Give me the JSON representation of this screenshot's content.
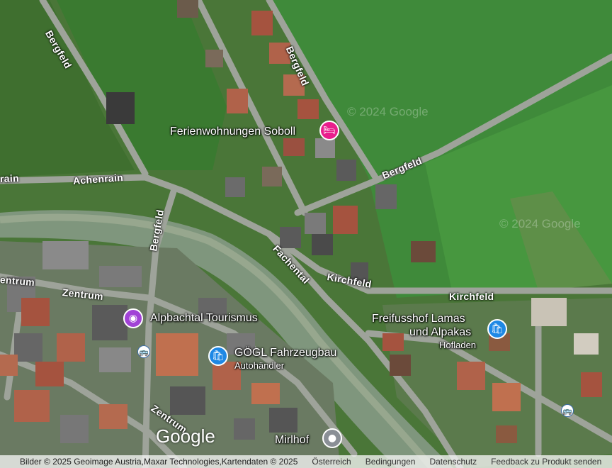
{
  "map": {
    "watermarks": [
      "© 2024 Google",
      "© 2024 Google"
    ],
    "streets": {
      "bergfeld_1": "Bergfeld",
      "bergfeld_2": "Bergfeld",
      "bergfeld_3": "Bergfeld",
      "bergfeld_4": "Bergfeld",
      "achenrain": "Achenrain",
      "achenrain_edge": "rain",
      "fachental": "Fachental",
      "kirchfeld_1": "Kirchfeld",
      "kirchfeld_2": "Kirchfeld",
      "zentrum_1": "Zentrum",
      "zentrum_2": "Zentrum",
      "zentrum_edge": "entrum"
    },
    "places": {
      "ferienwohnungen": {
        "name": "Ferienwohnungen Soboll",
        "icon": "bed-icon",
        "color": "#e91e8c"
      },
      "alpbachtal": {
        "name": "Alpbachtal Tourismus",
        "icon": "camera-icon",
        "color": "#a142d6"
      },
      "goegl": {
        "name": "GÖGL Fahrzeugbau",
        "sub": "Autohändler",
        "icon": "shopping-bag-icon",
        "color": "#1e88e5"
      },
      "freifusshof": {
        "name_line1": "Freifusshof Lamas",
        "name_line2": "und Alpakas",
        "sub": "Hofladen",
        "icon": "shopping-bag-icon",
        "color": "#1e88e5"
      },
      "mirlhof": {
        "name": "Mirlhof",
        "icon": "location-pin-icon",
        "color": "#8a8f96"
      }
    },
    "google_logo": "Google"
  },
  "footer": {
    "attribution": "Bilder © 2025 Geoimage Austria,Maxar Technologies,Kartendaten © 2025",
    "links": [
      "Österreich",
      "Bedingungen",
      "Datenschutz",
      "Feedback zu Produkt senden"
    ]
  }
}
